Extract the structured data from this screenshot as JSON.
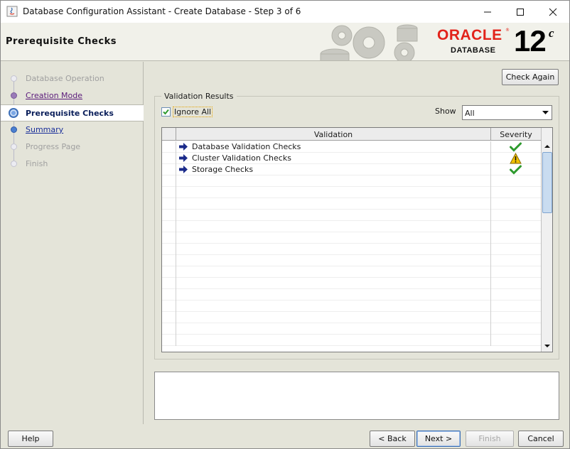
{
  "window": {
    "title": "Database Configuration Assistant - Create Database - Step 3 of 6"
  },
  "header": {
    "title": "Prerequisite Checks",
    "brand": "ORACLE",
    "product": "DATABASE",
    "version": "12",
    "version_suffix": "c"
  },
  "nav": {
    "items": [
      {
        "label": "Database Operation",
        "state": "disabled"
      },
      {
        "label": "Creation Mode",
        "state": "visited"
      },
      {
        "label": "Prerequisite Checks",
        "state": "current"
      },
      {
        "label": "Summary",
        "state": "next"
      },
      {
        "label": "Progress Page",
        "state": "disabled"
      },
      {
        "label": "Finish",
        "state": "disabled"
      }
    ]
  },
  "toolbar": {
    "check_again": "Check Again"
  },
  "validation": {
    "group_title": "Validation Results",
    "ignore_all_label": "Ignore All",
    "ignore_all_checked": true,
    "show_label": "Show",
    "show_value": "All",
    "columns": [
      "Validation",
      "Severity"
    ],
    "rows": [
      {
        "label": "Database Validation Checks",
        "severity": "success"
      },
      {
        "label": "Cluster Validation Checks",
        "severity": "warning"
      },
      {
        "label": "Storage Checks",
        "severity": "success"
      }
    ]
  },
  "details": {
    "text": ""
  },
  "footer": {
    "help": "Help",
    "back": "< Back",
    "next": "Next >",
    "finish": "Finish",
    "cancel": "Cancel"
  },
  "colors": {
    "oracle_red": "#e2231a",
    "success": "#2e9a2e",
    "warning": "#f2c200",
    "arrow": "#1a2a8a"
  }
}
